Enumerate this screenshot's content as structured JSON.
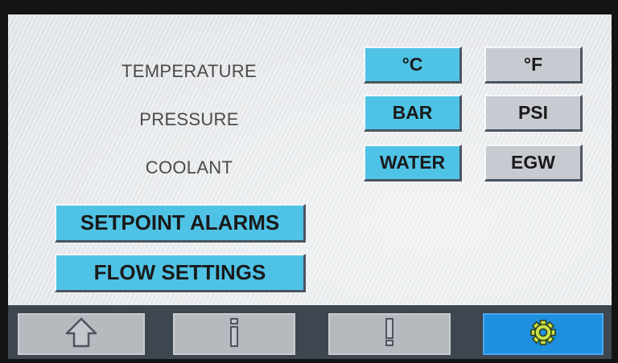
{
  "settings": {
    "rows": [
      {
        "label": "TEMPERATURE",
        "options": [
          "°C",
          "°F"
        ],
        "selected": 0
      },
      {
        "label": "PRESSURE",
        "options": [
          "BAR",
          "PSI"
        ],
        "selected": 0
      },
      {
        "label": "COOLANT",
        "options": [
          "WATER",
          "EGW"
        ],
        "selected": 0
      }
    ],
    "setpoint_alarms_label": "SETPOINT ALARMS",
    "flow_settings_label": "FLOW SETTINGS"
  },
  "navbar": {
    "items": [
      {
        "icon": "home-icon"
      },
      {
        "icon": "info-icon"
      },
      {
        "icon": "alert-icon"
      },
      {
        "icon": "gear-icon",
        "active": true
      }
    ]
  },
  "colors": {
    "selected": "#4fc3e6",
    "unselected": "#c8cad2",
    "active_nav": "#1f8fe0"
  }
}
